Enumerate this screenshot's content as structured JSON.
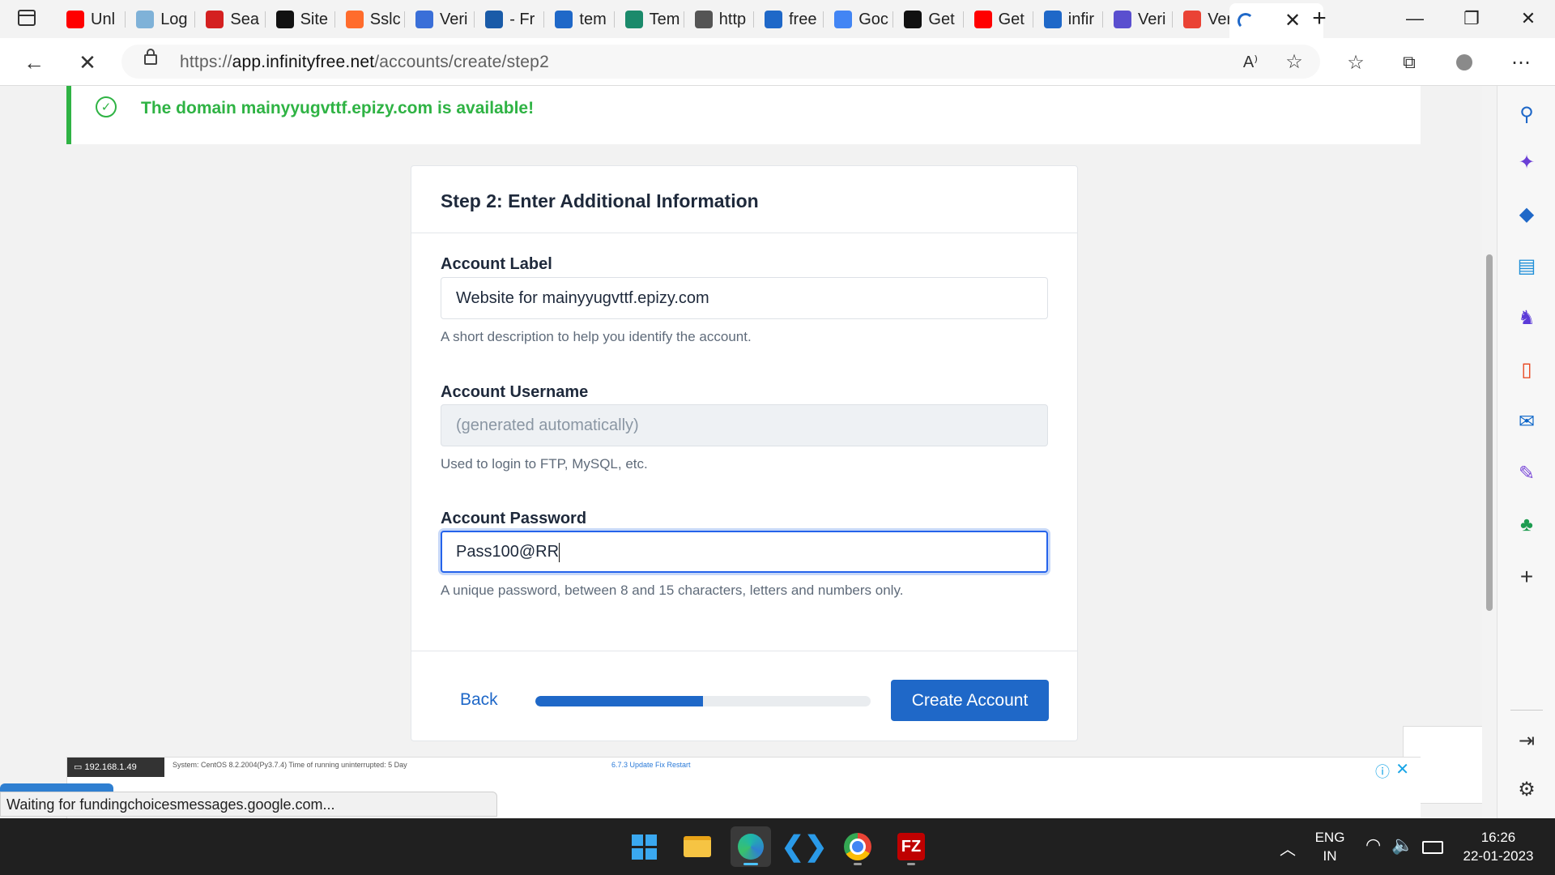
{
  "browser": {
    "tabs": [
      {
        "label": "Unl",
        "icon": "youtube-icon",
        "color": "#ff0000"
      },
      {
        "label": "Log",
        "icon": "globe-icon",
        "color": "#7fb2d8"
      },
      {
        "label": "Sea",
        "icon": "circle-3-icon",
        "color": "#d42020"
      },
      {
        "label": "Site",
        "icon": "sp-icon",
        "color": "#111111"
      },
      {
        "label": "Sslc",
        "icon": "cpanel-icon",
        "color": "#ff6c2c"
      },
      {
        "label": "Veri",
        "icon": "puzzle-icon",
        "color": "#3a6fd8"
      },
      {
        "label": "- Fr",
        "icon": "fn-icon",
        "color": "#1a5ba8"
      },
      {
        "label": "tem",
        "icon": "search-icon",
        "color": "#1f68c8"
      },
      {
        "label": "Tem",
        "icon": "templates-icon",
        "color": "#1b8a6b"
      },
      {
        "label": "http",
        "icon": "page-icon",
        "color": "#555555"
      },
      {
        "label": "free",
        "icon": "search-icon",
        "color": "#1f68c8"
      },
      {
        "label": "Goc",
        "icon": "google-icon",
        "color": "#4285f4"
      },
      {
        "label": "Get",
        "icon": "wix-icon",
        "color": "#111111"
      },
      {
        "label": "Get",
        "icon": "youtube-icon",
        "color": "#ff0000"
      },
      {
        "label": "infir",
        "icon": "search-icon",
        "color": "#1f68c8"
      },
      {
        "label": "Veri",
        "icon": "infinity-icon",
        "color": "#5a4fcf"
      },
      {
        "label": "Ver",
        "icon": "gmail-icon",
        "color": "#ea4335"
      }
    ],
    "url_prefix": "https://",
    "url_domain": "app.infinityfree.net",
    "url_path": "/accounts/create/step2",
    "status_text": "Waiting for fundingchoicesmessages.google.com..."
  },
  "page": {
    "alert_text": "The domain mainyyugvttf.epizy.com is available!",
    "card_title": "Step 2: Enter Additional Information",
    "fields": {
      "label": {
        "label": "Account Label",
        "value": "Website for mainyyugvttf.epizy.com",
        "help": "A short description to help you identify the account."
      },
      "username": {
        "label": "Account Username",
        "placeholder": "(generated automatically)",
        "help": "Used to login to FTP, MySQL, etc."
      },
      "password": {
        "label": "Account Password",
        "value": "Pass100@RR",
        "help": "A unique password, between 8 and 15 characters, letters and numbers only."
      }
    },
    "back_label": "Back",
    "progress": 0.5,
    "create_label": "Create Account",
    "accent_color": "#1f68c8",
    "success_color": "#2fb344"
  },
  "ad": {
    "ip": "192.168.1.49",
    "system_text": "System:   CentOS 8.2.2004(Py3.7.4)      Time of running uninterrupted: 5 Day",
    "version_text": "6.7.3   Update   Fix   Restart"
  },
  "taskbar": {
    "lang_line1": "ENG",
    "lang_line2": "IN",
    "time": "16:26",
    "date": "22-01-2023"
  }
}
